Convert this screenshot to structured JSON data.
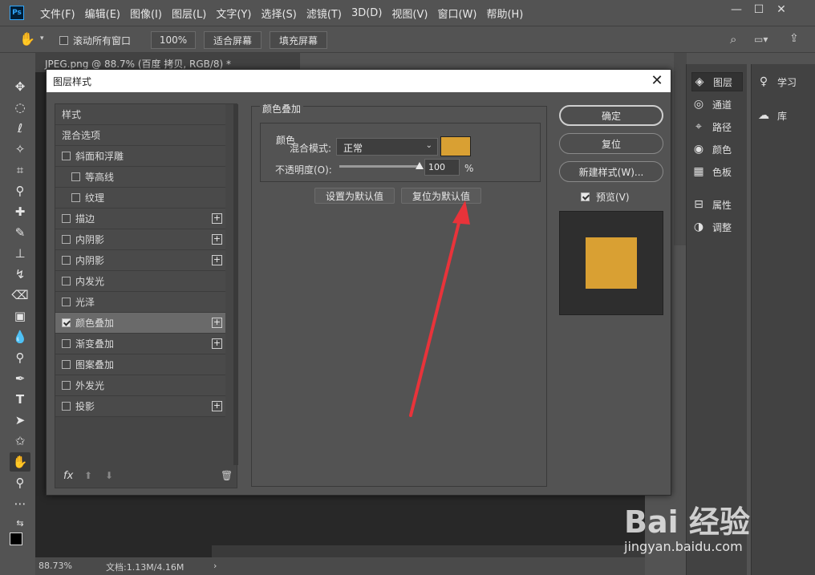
{
  "app": {
    "logo_text": "Ps",
    "menu": [
      "文件(F)",
      "编辑(E)",
      "图像(I)",
      "图层(L)",
      "文字(Y)",
      "选择(S)",
      "滤镜(T)",
      "3D(D)",
      "视图(V)",
      "窗口(W)",
      "帮助(H)"
    ]
  },
  "options_bar": {
    "scroll_all_label": "滚动所有窗口",
    "zoom_btn": "100%",
    "fit_screen": "适合屏幕",
    "fill_screen": "填充屏幕"
  },
  "document": {
    "tab_title": "JPEG.png @ 88.7% (百度 拷贝, RGB/8) *",
    "status_zoom": "88.73%",
    "status_doc": "文档:1.13M/4.16M",
    "status_arrow": "›"
  },
  "panels": {
    "strip1": [
      "图层",
      "通道",
      "路径",
      "颜色",
      "色板",
      "属性",
      "调整"
    ],
    "strip2": [
      "学习",
      "库"
    ]
  },
  "dialog": {
    "title": "图层样式",
    "style_list": [
      {
        "label": "样式",
        "check": false,
        "hascheck": false,
        "plus": false,
        "indent": 0
      },
      {
        "label": "混合选项",
        "check": false,
        "hascheck": false,
        "plus": false,
        "indent": 0
      },
      {
        "label": "斜面和浮雕",
        "check": false,
        "hascheck": true,
        "plus": false,
        "indent": 0
      },
      {
        "label": "等高线",
        "check": false,
        "hascheck": true,
        "plus": false,
        "indent": 1
      },
      {
        "label": "纹理",
        "check": false,
        "hascheck": true,
        "plus": false,
        "indent": 1
      },
      {
        "label": "描边",
        "check": false,
        "hascheck": true,
        "plus": true,
        "indent": 0
      },
      {
        "label": "内阴影",
        "check": false,
        "hascheck": true,
        "plus": true,
        "indent": 0
      },
      {
        "label": "内阴影",
        "check": false,
        "hascheck": true,
        "plus": true,
        "indent": 0
      },
      {
        "label": "内发光",
        "check": false,
        "hascheck": true,
        "plus": false,
        "indent": 0
      },
      {
        "label": "光泽",
        "check": false,
        "hascheck": true,
        "plus": false,
        "indent": 0
      },
      {
        "label": "颜色叠加",
        "check": true,
        "hascheck": true,
        "plus": true,
        "indent": 0,
        "selected": true
      },
      {
        "label": "渐变叠加",
        "check": false,
        "hascheck": true,
        "plus": true,
        "indent": 0
      },
      {
        "label": "图案叠加",
        "check": false,
        "hascheck": true,
        "plus": false,
        "indent": 0
      },
      {
        "label": "外发光",
        "check": false,
        "hascheck": true,
        "plus": false,
        "indent": 0
      },
      {
        "label": "投影",
        "check": false,
        "hascheck": true,
        "plus": true,
        "indent": 0
      }
    ],
    "footer_fx": "fx",
    "section_title": "颜色叠加",
    "color_group": "颜色",
    "blend_mode_label": "混合模式:",
    "blend_mode_value": "正常",
    "overlay_color": "#d9a033",
    "opacity_label": "不透明度(O):",
    "opacity_value": "100",
    "opacity_unit": "%",
    "opacity_level": 1.0,
    "set_default": "设置为默认值",
    "reset_default": "复位为默认值",
    "ok": "确定",
    "reset": "复位",
    "new_style": "新建样式(W)...",
    "preview_label": "预览(V)",
    "preview_checked": true
  },
  "watermark": {
    "logo": "Bai  经验",
    "url": "jingyan.baidu.com"
  },
  "colors": {
    "annotation_arrow": "#e8333a"
  }
}
